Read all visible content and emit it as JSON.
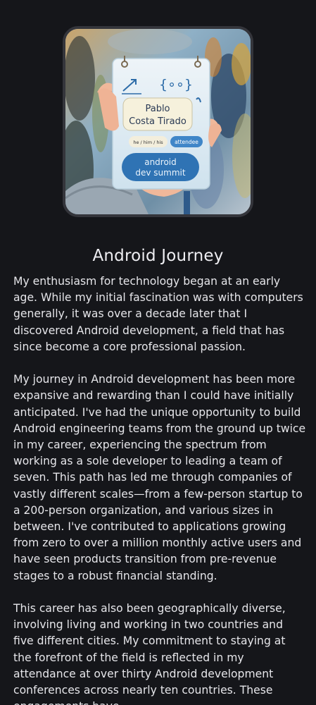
{
  "hero": {
    "badge_name_line1": "Pablo",
    "badge_name_line2": "Costa Tirado",
    "badge_pronouns": "he / him / his",
    "badge_role": "attendee",
    "badge_event_line1": "android",
    "badge_event_line2": "dev summit",
    "badge_code_glyph": "{∘∘}"
  },
  "title": "Android Journey",
  "paragraphs": [
    "My enthusiasm for technology began at an early age. While my initial fascination was with computers generally, it was over a decade later that I discovered Android development, a field that has since become a core professional passion.",
    "My journey in Android development has been more expansive and rewarding than I could have initially anticipated. I've had the unique opportunity to build Android engineering teams from the ground up twice in my career, experiencing the spectrum from working as a sole developer to leading a team of seven. This path has led me through companies of vastly different scales—from a few-person startup to a 200-person organization, and various sizes in between. I've contributed to applications growing from zero to over a million monthly active users and have seen products transition from pre-revenue stages to a robust financial standing.",
    "This career has also been geographically diverse, involving living and working in two countries and five different cities. My commitment to staying at the forefront of the field is reflected in my attendance at over thirty Android development conferences across nearly ten countries. These engagements have"
  ]
}
